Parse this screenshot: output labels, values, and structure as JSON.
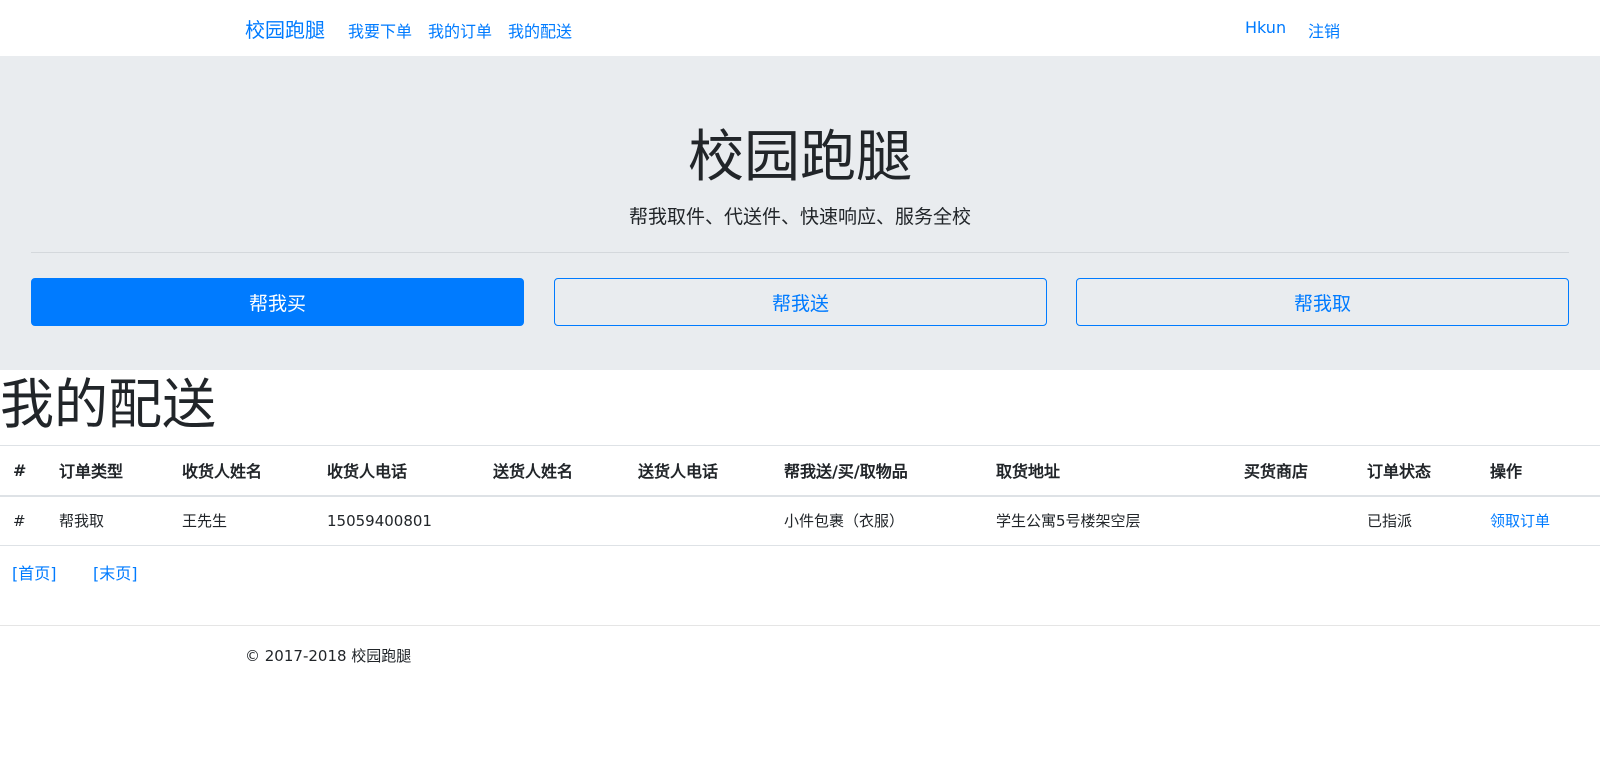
{
  "navbar": {
    "brand": "校园跑腿",
    "links": [
      "我要下单",
      "我的订单",
      "我的配送"
    ],
    "user": "Hkun",
    "logout": "注销"
  },
  "hero": {
    "title": "校园跑腿",
    "subtitle": "帮我取件、代送件、快速响应、服务全校",
    "buttons": [
      "帮我买",
      "帮我送",
      "帮我取"
    ]
  },
  "section": {
    "title": "我的配送"
  },
  "table": {
    "headers": [
      "#",
      "订单类型",
      "收货人姓名",
      "收货人电话",
      "送货人姓名",
      "送货人电话",
      "帮我送/买/取物品",
      "取货地址",
      "买货商店",
      "订单状态",
      "操作"
    ],
    "rows": [
      {
        "num": "#",
        "type": "帮我取",
        "receiver_name": "王先生",
        "receiver_phone": "15059400801",
        "sender_name": "",
        "sender_phone": "",
        "item": "小件包裹（衣服）",
        "pickup_address": "学生公寓5号楼架空层",
        "store": "",
        "status": "已指派",
        "action": "领取订单"
      }
    ]
  },
  "pager": {
    "first": "[首页]",
    "last": "[末页]"
  },
  "footer": {
    "text": "© 2017-2018 校园跑腿"
  }
}
